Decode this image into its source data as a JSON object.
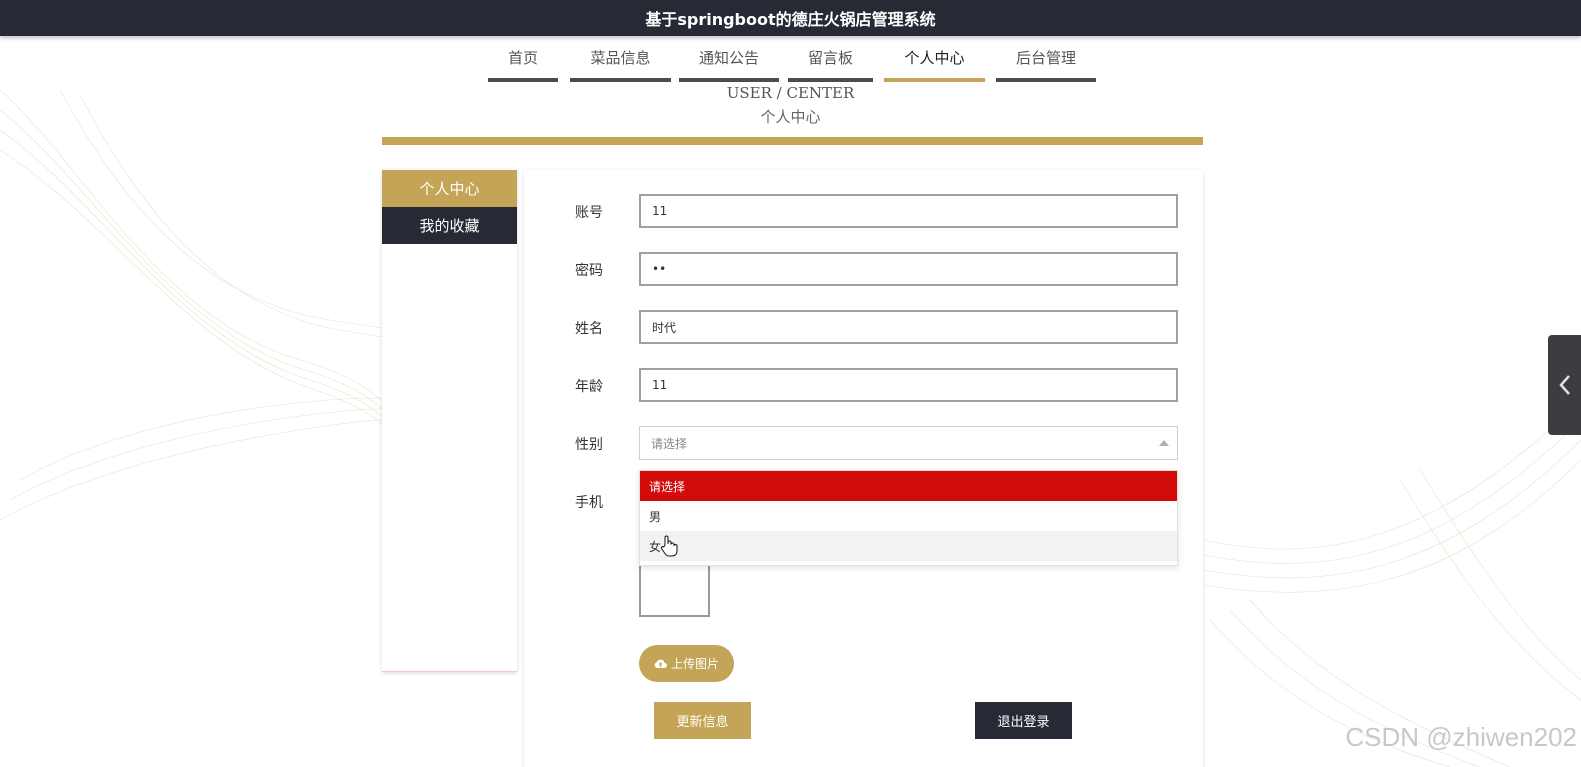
{
  "app": {
    "title": "基于springboot的德庄火锅店管理系统"
  },
  "nav": {
    "items": [
      {
        "label": "首页",
        "active": false
      },
      {
        "label": "菜品信息",
        "active": false
      },
      {
        "label": "通知公告",
        "active": false
      },
      {
        "label": "留言板",
        "active": false
      },
      {
        "label": "个人中心",
        "active": true
      },
      {
        "label": "后台管理",
        "active": false
      }
    ]
  },
  "section": {
    "title_en": "USER / CENTER",
    "title_zh": "个人中心"
  },
  "sidebar": {
    "items": [
      {
        "label": "个人中心",
        "active": true
      },
      {
        "label": "我的收藏",
        "active": false
      }
    ]
  },
  "form": {
    "account": {
      "label": "账号",
      "value": "11"
    },
    "password": {
      "label": "密码",
      "value": "••"
    },
    "name": {
      "label": "姓名",
      "value": "时代"
    },
    "age": {
      "label": "年龄",
      "value": "11"
    },
    "gender": {
      "label": "性别",
      "placeholder": "请选择",
      "options": [
        "请选择",
        "男",
        "女"
      ],
      "selected": "请选择",
      "hovered": "女"
    },
    "phone": {
      "label": "手机"
    },
    "upload_label": "上传图片",
    "update_label": "更新信息",
    "logout_label": "退出登录"
  },
  "watermark": "CSDN @zhiwen202",
  "colors": {
    "accent": "#c4a457",
    "dark": "#262a35",
    "dropdown_selected": "#d10a0a"
  },
  "icons": {
    "upload": "cloud-upload-icon",
    "side_tab": "chevron-left-icon",
    "cursor": "hand-pointer-icon"
  }
}
